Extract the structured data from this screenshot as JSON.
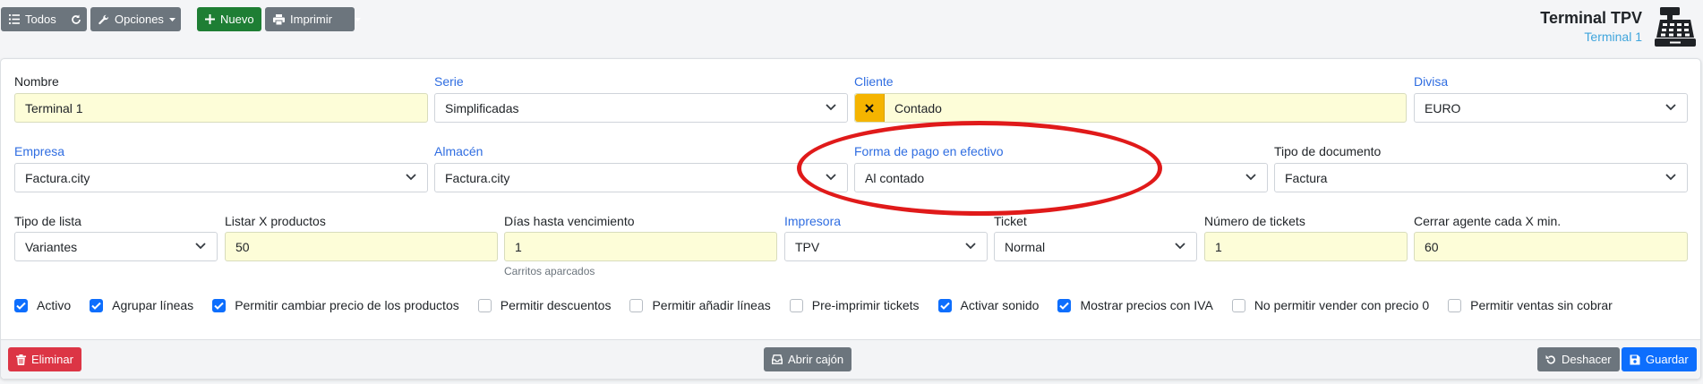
{
  "toolbar": {
    "all_label": "Todos",
    "options_label": "Opciones",
    "new_label": "Nuevo",
    "print_label": "Imprimir"
  },
  "header": {
    "title": "Terminal TPV",
    "subtitle": "Terminal 1"
  },
  "form": {
    "nombre": {
      "label": "Nombre",
      "value": "Terminal 1"
    },
    "serie": {
      "label": "Serie",
      "value": "Simplificadas"
    },
    "cliente": {
      "label": "Cliente",
      "value": "Contado"
    },
    "divisa": {
      "label": "Divisa",
      "value": "EURO"
    },
    "empresa": {
      "label": "Empresa",
      "value": "Factura.city"
    },
    "almacen": {
      "label": "Almacén",
      "value": "Factura.city"
    },
    "forma_pago": {
      "label": "Forma de pago en efectivo",
      "value": "Al contado"
    },
    "tipo_documento": {
      "label": "Tipo de documento",
      "value": "Factura"
    },
    "tipo_lista": {
      "label": "Tipo de lista",
      "value": "Variantes"
    },
    "listar_productos": {
      "label": "Listar X productos",
      "value": "50"
    },
    "dias_vencimiento": {
      "label": "Días hasta vencimiento",
      "value": "1",
      "help": "Carritos aparcados"
    },
    "impresora": {
      "label": "Impresora",
      "value": "TPV"
    },
    "ticket": {
      "label": "Ticket",
      "value": "Normal"
    },
    "num_tickets": {
      "label": "Número de tickets",
      "value": "1"
    },
    "cerrar_agente": {
      "label": "Cerrar agente cada X min.",
      "value": "60"
    }
  },
  "checkboxes": [
    {
      "label": "Activo",
      "checked": true
    },
    {
      "label": "Agrupar líneas",
      "checked": true
    },
    {
      "label": "Permitir cambiar precio de los productos",
      "checked": true
    },
    {
      "label": "Permitir descuentos",
      "checked": false
    },
    {
      "label": "Permitir añadir líneas",
      "checked": false
    },
    {
      "label": "Pre-imprimir tickets",
      "checked": false
    },
    {
      "label": "Activar sonido",
      "checked": true
    },
    {
      "label": "Mostrar precios con IVA",
      "checked": true
    },
    {
      "label": "No permitir vender con precio 0",
      "checked": false
    },
    {
      "label": "Permitir ventas sin cobrar",
      "checked": false
    }
  ],
  "footer": {
    "delete_label": "Eliminar",
    "open_drawer_label": "Abrir cajón",
    "undo_label": "Deshacer",
    "save_label": "Guardar"
  },
  "colors": {
    "accent": "#0d6efd",
    "success": "#1e7e34",
    "danger": "#dc3545",
    "secondary": "#6c757d",
    "warning": "#f5b400",
    "link": "#2f6de1",
    "annotation": "#e01a1a"
  }
}
